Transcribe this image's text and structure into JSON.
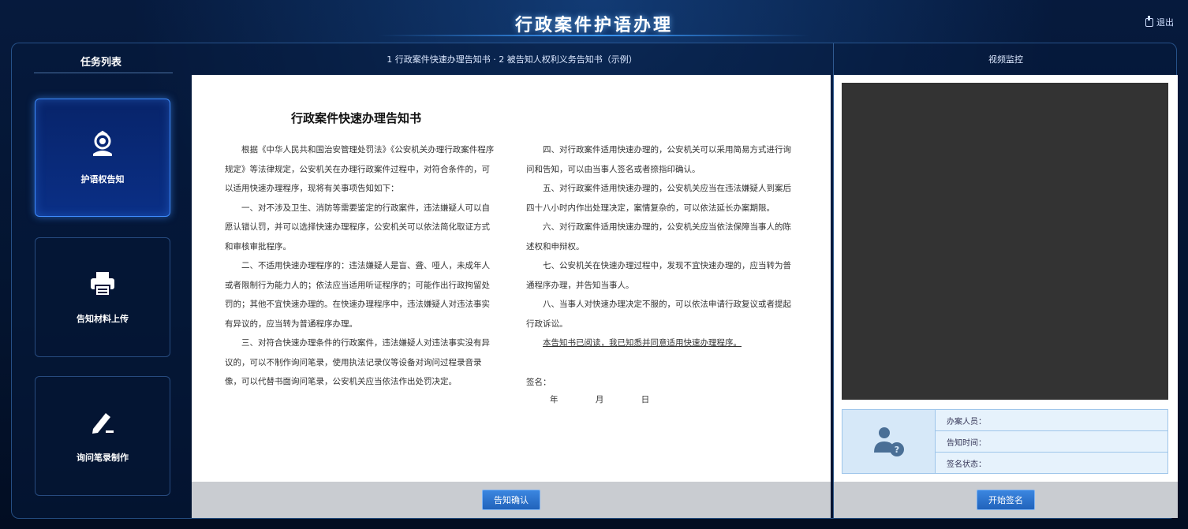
{
  "header": {
    "title": "行政案件护语办理",
    "exit_label": "退出"
  },
  "sidebar": {
    "title": "任务列表",
    "items": [
      {
        "label": "护语权告知",
        "icon": "police-badge-icon",
        "active": true
      },
      {
        "label": "告知材料上传",
        "icon": "printer-icon",
        "active": false
      },
      {
        "label": "询问笔录制作",
        "icon": "pen-edit-icon",
        "active": false
      }
    ]
  },
  "center": {
    "header_text": "1 行政案件快速办理告知书 · 2 被告知人权利义务告知书（示例）",
    "document": {
      "title": "行政案件快速办理告知书",
      "col1": [
        "根据《中华人民共和国治安管理处罚法》《公安机关办理行政案件程序规定》等法律规定，公安机关在办理行政案件过程中，对符合条件的，可以适用快速办理程序，现将有关事项告知如下：",
        "一、对不涉及卫生、消防等需要鉴定的行政案件，违法嫌疑人可以自愿认错认罚，并可以选择快速办理程序，公安机关可以依法简化取证方式和审核审批程序。",
        "二、不适用快速办理程序的：违法嫌疑人是盲、聋、哑人，未成年人或者限制行为能力人的；依法应当适用听证程序的；可能作出行政拘留处罚的；其他不宜快速办理的。在快速办理程序中，违法嫌疑人对违法事实有异议的，应当转为普通程序办理。",
        "三、对符合快速办理条件的行政案件，违法嫌疑人对违法事实没有异议的，可以不制作询问笔录，使用执法记录仪等设备对询问过程录音录像，可以代替书面询问笔录，公安机关应当依法作出处罚决定。"
      ],
      "col2": [
        "四、对行政案件适用快速办理的，公安机关可以采用简易方式进行询问和告知，可以由当事人签名或者捺指印确认。",
        "五、对行政案件适用快速办理的，公安机关应当在违法嫌疑人到案后四十八小时内作出处理决定，案情复杂的，可以依法延长办案期限。",
        "六、对行政案件适用快速办理的，公安机关应当依法保障当事人的陈述权和申辩权。",
        "七、公安机关在快速办理过程中，发现不宜快速办理的，应当转为普通程序办理，并告知当事人。",
        "八、当事人对快速办理决定不服的，可以依法申请行政复议或者提起行政诉讼。"
      ],
      "col2_underline": "本告知书已阅读，我已知悉并同意适用快速办理程序。",
      "signature_label": "签名：",
      "date_parts": [
        "年",
        "月",
        "日"
      ]
    },
    "confirm_button": "告知确认"
  },
  "right": {
    "header_text": "视频监控",
    "info": {
      "rows": [
        "办案人员：",
        "告知时间：",
        "签名状态："
      ]
    },
    "sign_button": "开始签名"
  }
}
